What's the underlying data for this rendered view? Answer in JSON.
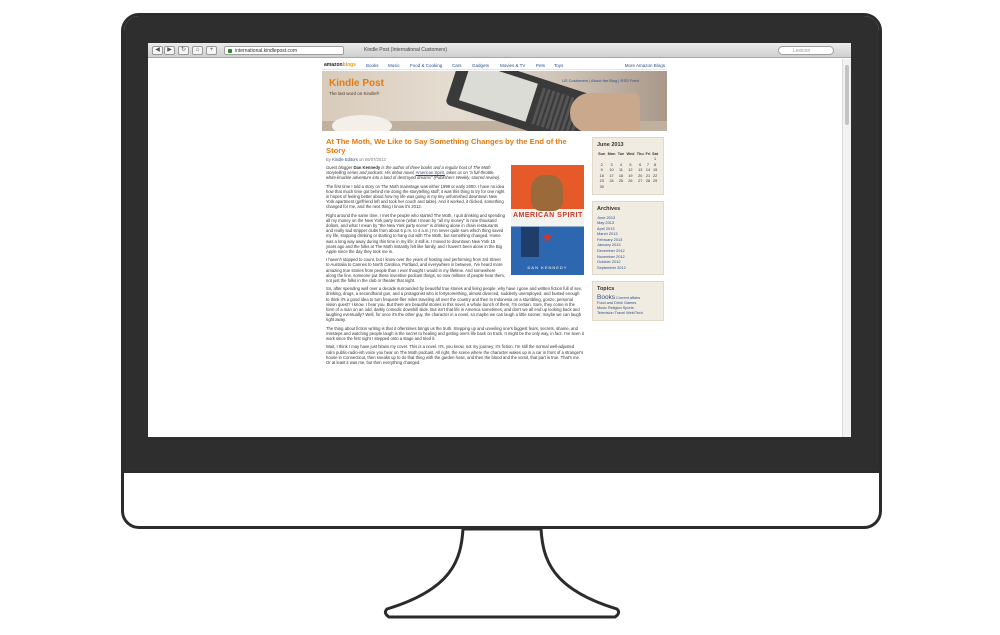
{
  "browser": {
    "url": "international.kindlepost.com",
    "title": "Kindle Post (International Customers)",
    "search_placeholder": "Lexicon"
  },
  "amazon_bar": {
    "logo": "amazon",
    "logo_suffix": "blogs",
    "nav": [
      "Books",
      "Music",
      "Food & Cooking",
      "Cars",
      "Gadgets",
      "Movies & TV",
      "Pets",
      "Toys"
    ],
    "more": "More Amazon Blogs"
  },
  "banner": {
    "title": "Kindle Post",
    "tagline": "The last word on Kindle®",
    "links": "US Customers  |  About the Blog  |  RSS Feed"
  },
  "post": {
    "title": "At The Moth, We Like to Say Something Changes by the End of the Story",
    "byline_prefix": "By",
    "author": "Kindle Editors",
    "byline_suffix": "on 06/07/2013",
    "intro_lead": "Guest blogger",
    "intro_name": "Dan Kennedy",
    "intro_rest": "is the author of three books and a regular host of The Moth storytelling series and podcast. His debut novel,",
    "intro_link": "American Spirit,",
    "intro_tail": "takes us on \"a full-throttle, white-knuckle adventure into a land of destroyed dreams\" (Publishers Weekly, starred review).",
    "paragraphs": [
      "The first time I told a story on The Moth mainstage was either 1999 or early 2000. I have no idea how that much time got behind me doing the storytelling stuff; it was this thing to try for one night in hopes of feeling better about how my life was going in my tiny unfurnished downtown New York apartment (girlfriend left and took her couch and table). And it worked, it clicked, something changed for me, and the next thing I know it's 2013.",
      "Right around the same time, I met the people who started The Moth, I quit drinking and spending all my money on the New York party scene (what I mean by \"all my money\" is nine thousand dollars, and what I mean by \"the New York party scene\" is drinking alone in chain restaurants and really sad stripper clubs from about 6 p.m. to 4 a.m.) I'm never quite sure which thing saved my life, stopping drinking or starting to hang out with The Moth, but something changed. Home was a long way away during this time in my life; it still is. I moved to downtown New York 15 years ago and the folks at The Moth instantly felt like family, and I haven't been alone in the Big Apple since the day they took me in.",
      "I haven't stopped to count, but I know over the years of hosting and performing from 3rd Street to Australia to Cannes to North Carolina, Portland, and everywhere in between, I've heard more amazing true stories from people than I ever thought I would in my lifetime. And somewhere along the line, someone put these inventive podcast things, so now millions of people hear them, not just the folks in the club or theater that night.",
      "So, after spending well over a decade surrounded by beautiful true stories and living people, why have I gone and written fiction full of sex, drinking, drugs, a secondhand gun, and a protagonist who is fortysomething, almost divorced, suddenly unemployed, and busted enough to think it's a good idea to turn frequent-flier miles traveling all over the country and then to Indonesia on a stumbling, gonzo, personal vision quest? I know, I hear you. But there are beautiful stories in this novel, a whole bunch of them, I'm certain. Sure, they come in the form of a man on an odd, darkly comedic downhill slide. But isn't that life in America sometimes, and don't we all end up looking back and laughing eventually? Well, for once it's the other guy, the character in a novel, so maybe we can laugh a little sooner, maybe we can laugh right away.",
      "The thing about fiction writing is that it oftentimes brings us the truth. Stepping up and unveiling one's biggest fears, secrets, shame, and missteps and watching people laugh is the secret to healing and getting one's life back on track. It might be the only way, in fact. I've seen it work since the first night I stepped onto a stage and tried it.",
      "Wait, I think I may have just blown my cover. This is a novel. It's, you know, not my journey; it's fiction. I'm still the normal well-adjusted calm public-radio-ish voice you hear on The Moth podcast. All right, the scene where the character wakes up in a car in front of a stranger's house in Connecticut, then sneaks up to do that thing with the garden hose, and then the blood and the vomit, that part is true. That's me. Or at least it was me, but then everything changed."
    ]
  },
  "book": {
    "title": "AMERICAN SPIRIT",
    "author": "DAN KENNEDY"
  },
  "calendar": {
    "title": "June 2013",
    "days": [
      "Sun",
      "Mon",
      "Tue",
      "Wed",
      "Thu",
      "Fri",
      "Sat"
    ],
    "weeks": [
      [
        "",
        "",
        "",
        "",
        "",
        "",
        "1"
      ],
      [
        "2",
        "3",
        "4",
        "5",
        "6",
        "7",
        "8"
      ],
      [
        "9",
        "10",
        "11",
        "12",
        "13",
        "14",
        "15"
      ],
      [
        "16",
        "17",
        "18",
        "19",
        "20",
        "21",
        "22"
      ],
      [
        "23",
        "24",
        "25",
        "26",
        "27",
        "28",
        "29"
      ],
      [
        "30",
        "",
        "",
        "",
        "",
        "",
        ""
      ]
    ]
  },
  "archives": {
    "title": "Archives",
    "items": [
      "June 2013",
      "May 2013",
      "April 2013",
      "March 2013",
      "February 2013",
      "January 2013",
      "December 2012",
      "November 2012",
      "October 2012",
      "September 2012"
    ]
  },
  "topics": {
    "title": "Topics",
    "big": "Books",
    "lines": [
      "Current affairs",
      "Food and Drink   Games",
      "Music   Religion   Sports",
      "Television   Travel   Web/Tech"
    ]
  }
}
